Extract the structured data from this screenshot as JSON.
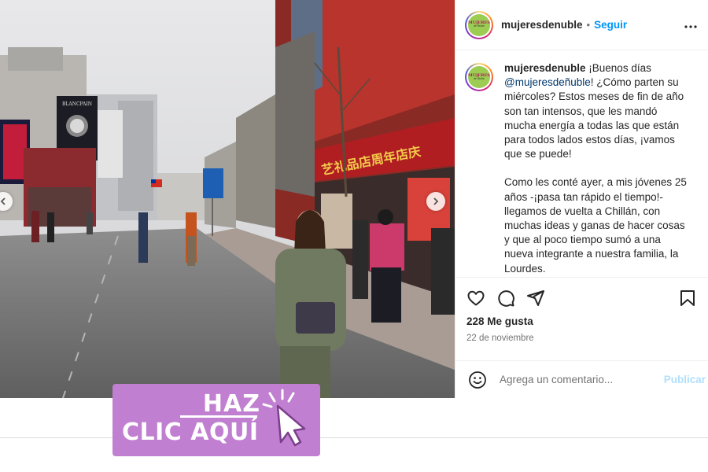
{
  "post": {
    "username": "mujeresdenuble",
    "separator": "•",
    "follow_label": "Seguir",
    "more_label": "•••",
    "avatar_text_main": "MUJERES",
    "avatar_text_sub": "de Ñuble",
    "caption": {
      "username": "mujeresdenuble",
      "text_1a": " ¡Buenos días ",
      "mention": "@mujeresdeñuble",
      "text_1b": "! ¿Cómo parten su miércoles? Estos meses de fin de año son tan intensos, que les mandó mucha energía a todas las que están para todos lados estos días, ¡vamos que se puede!",
      "text_2": "Como les conté ayer, a mis jóvenes 25 años -¡pasa tan rápido el tiempo!- llegamos de vuelta a Chillán, con muchas ideas y ganas de hacer cosas y que al poco tiempo sumó a una nueva integrante a nuestra familia, la Lourdes."
    },
    "likes": "228 Me gusta",
    "date": "22 de noviembre",
    "comment_placeholder": "Agrega un comentario...",
    "publish_label": "Publicar"
  },
  "photo": {
    "sign_text": "艺礼品店周年店庆",
    "billboard_text": "BLANCPAIN"
  },
  "cta": {
    "line1": "HAZ",
    "line2": "CLIC AQUÍ"
  },
  "colors": {
    "follow": "#0095f6",
    "cta": "#c07fd0",
    "publish_disabled": "#b2dffc"
  }
}
